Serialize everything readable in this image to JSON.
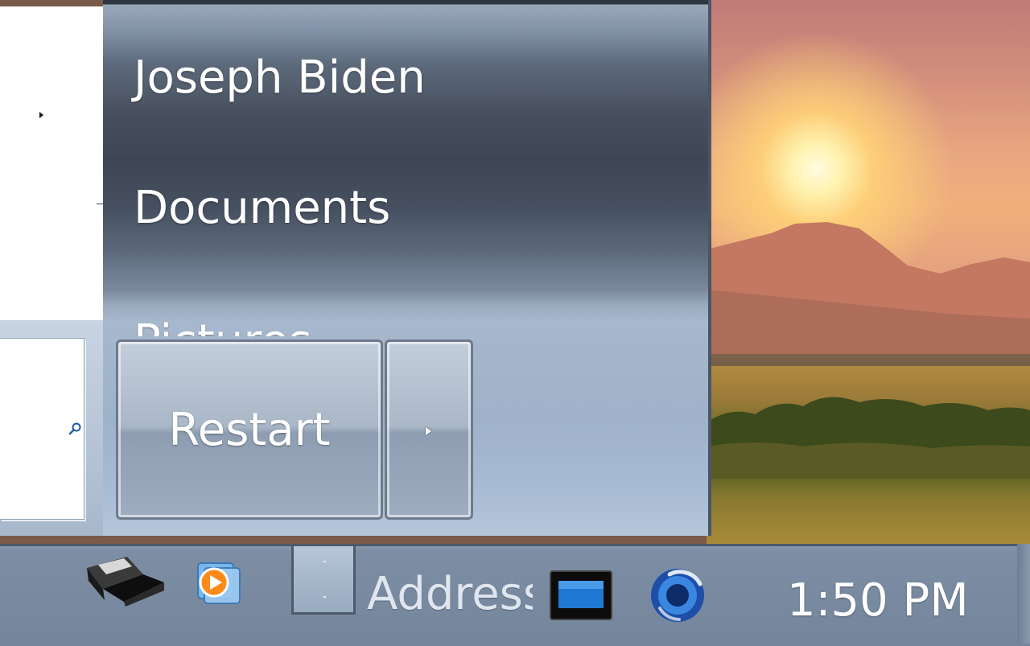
{
  "start_menu": {
    "right_pane": {
      "items": [
        {
          "label": "Joseph Biden"
        },
        {
          "label": "Documents"
        },
        {
          "label": "Pictures"
        }
      ]
    },
    "left_pane": {
      "search_placeholder": ""
    },
    "shutdown": {
      "primary_label": "Restart"
    }
  },
  "taskbar": {
    "address_label": "Address",
    "clock": "1:50 PM",
    "quick_launch": [
      "printer-icon",
      "media-player-icon"
    ],
    "tray": [
      "display-icon",
      "volume-icon"
    ]
  },
  "colors": {
    "pane_dark": "#3e4654",
    "pane_light": "#a7b8cd",
    "taskbar": "#7d8ea4",
    "text": "#ffffff"
  }
}
